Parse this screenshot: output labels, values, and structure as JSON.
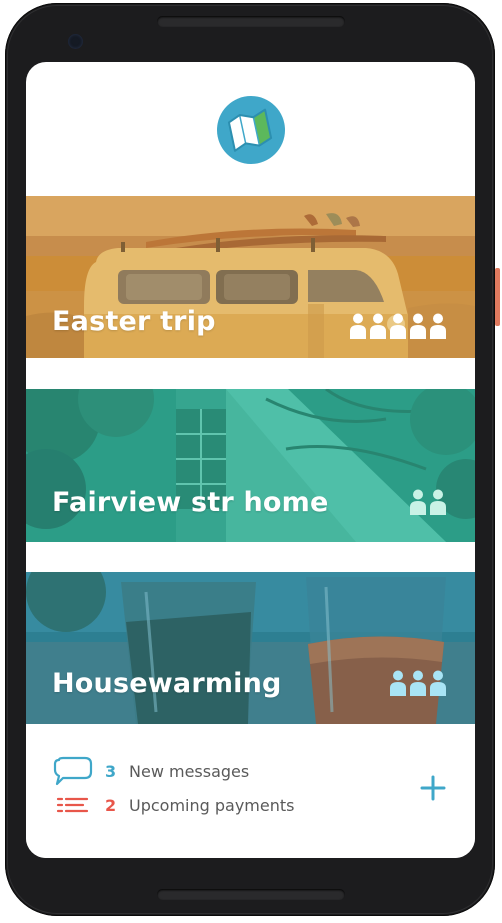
{
  "app": {
    "logo_icon": "folded-map-icon",
    "accent_color": "#3fa7c9",
    "alert_color": "#e8564a"
  },
  "events": [
    {
      "title": "Easter trip",
      "image": "van with surfboards on beach",
      "tint": "#d9962e",
      "member_count": 5,
      "member_color": "#ffffff"
    },
    {
      "title": "Fairview str home",
      "image": "a-frame house among trees",
      "tint": "#2fa38c",
      "member_count": 2,
      "member_color": "#c9f2e6"
    },
    {
      "title": "Housewarming",
      "image": "drinks in glasses on table",
      "tint": "#2d7f92",
      "member_count": 3,
      "member_color": "#a9e4f5"
    }
  ],
  "notifications": {
    "messages": {
      "count": "3",
      "label": "New messages",
      "icon": "chat-bubble-icon"
    },
    "payments": {
      "count": "2",
      "label": "Upcoming payments",
      "icon": "list-icon"
    }
  },
  "add_button": {
    "icon": "plus-icon"
  }
}
